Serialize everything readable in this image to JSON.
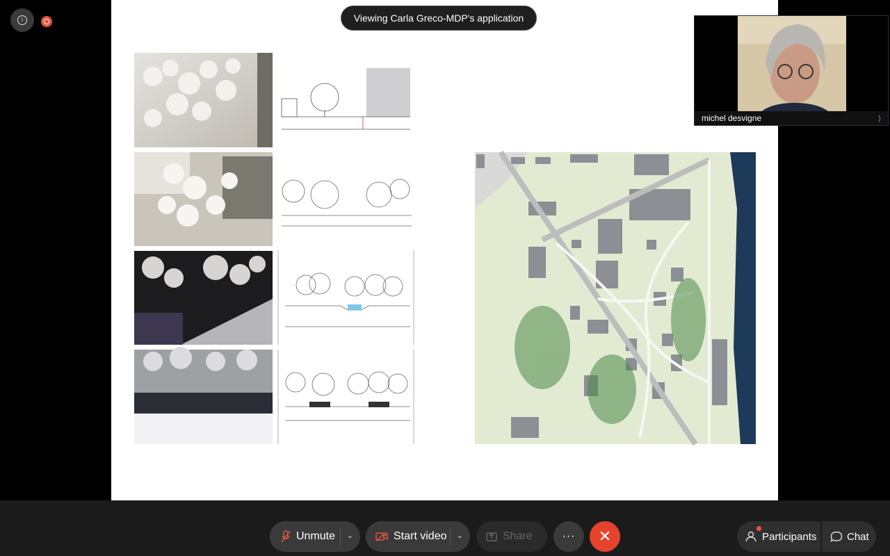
{
  "banner": {
    "text": "Viewing Carla Greco-MDP's application"
  },
  "participant": {
    "name": "michel desvigne"
  },
  "toolbar": {
    "unmute_label": "Unmute",
    "start_video_label": "Start video",
    "share_label": "Share",
    "more_label": "···",
    "end_label": "✕",
    "participants_label": "Participants",
    "chat_label": "Chat"
  },
  "icons": {
    "info": "info-icon",
    "record": "record-icon",
    "mic_off": "mic-off-icon",
    "video_off": "video-off-icon",
    "share": "share-icon",
    "participants": "participants-icon",
    "chat": "chat-icon"
  },
  "colors": {
    "end_call": "#e5432d",
    "record": "#e8533f",
    "audio_indicator": "#39a8ff",
    "participants_dot": "#ff4a3d"
  }
}
